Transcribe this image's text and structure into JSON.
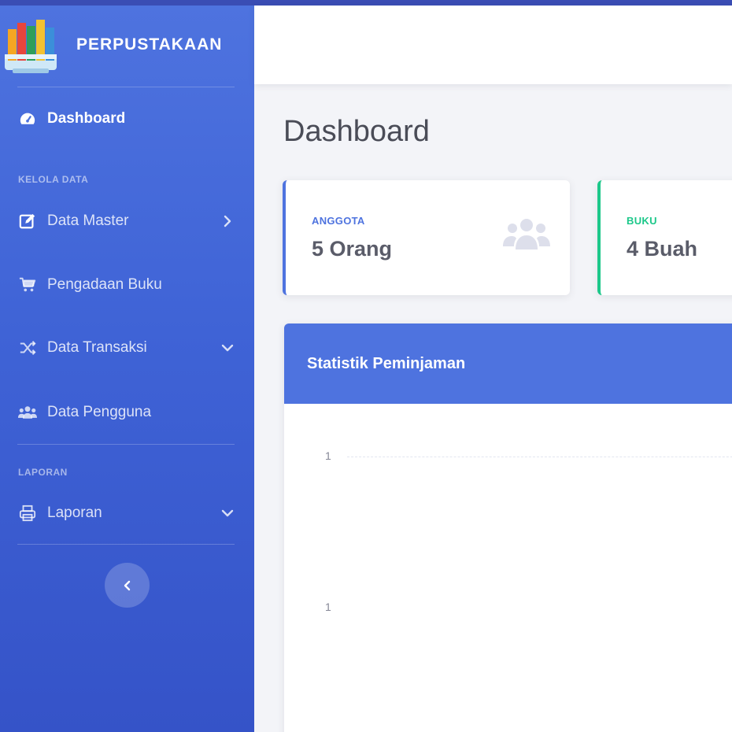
{
  "brand": {
    "name": "PERPUSTAKAAN"
  },
  "sidebar": {
    "items": [
      {
        "label": "Dashboard",
        "icon": "tachometer-icon",
        "active": true
      },
      {
        "heading": "KELOLA DATA"
      },
      {
        "label": "Data Master",
        "icon": "edit-icon",
        "chevron": "chevron-right-icon"
      },
      {
        "label": "Pengadaan Buku",
        "icon": "cart-icon"
      },
      {
        "label": "Data Transaksi",
        "icon": "random-icon",
        "chevron": "chevron-down-icon"
      },
      {
        "label": "Data Pengguna",
        "icon": "users-icon"
      },
      {
        "heading": "LAPORAN"
      },
      {
        "label": "Laporan",
        "icon": "print-icon",
        "chevron": "chevron-down-icon"
      }
    ],
    "toggle_icon": "chevron-left-icon"
  },
  "page": {
    "title": "Dashboard"
  },
  "cards": [
    {
      "label": "ANGGOTA",
      "value": "5 Orang",
      "color": "#4e73df",
      "icon": "users-icon"
    },
    {
      "label": "BUKU",
      "value": "4 Buah",
      "color": "#1cc88a"
    }
  ],
  "panel": {
    "title": "Statistik Peminjaman",
    "y_ticks": [
      "1",
      "1"
    ]
  },
  "colors": {
    "primary": "#4e73df",
    "success": "#1cc88a",
    "text": "#5a5c69"
  }
}
